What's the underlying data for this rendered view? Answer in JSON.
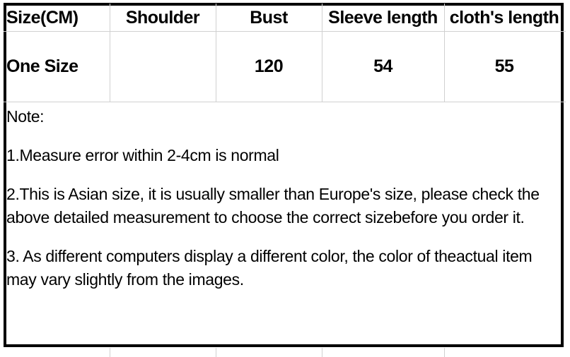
{
  "table": {
    "headers": [
      "Size(CM)",
      "Shoulder",
      "Bust",
      "Sleeve length",
      "cloth's length"
    ],
    "rows": [
      {
        "size": "One Size",
        "shoulder": "",
        "bust": "120",
        "sleeve_length": "54",
        "cloth_length": "55"
      }
    ]
  },
  "notes": {
    "title": "Note:",
    "items": [
      "1.Measure error within 2-4cm is normal",
      "2.This is Asian size, it is usually smaller than Europe's size, please check the above detailed measurement to choose the correct sizebefore you order it.",
      "3. As different computers display a different color, the color of theactual item may vary slightly from the images."
    ]
  },
  "colors": {
    "background": "#ffffff",
    "text": "#000000",
    "frame_border": "#000000",
    "grid_line": "#d0d0d0"
  }
}
